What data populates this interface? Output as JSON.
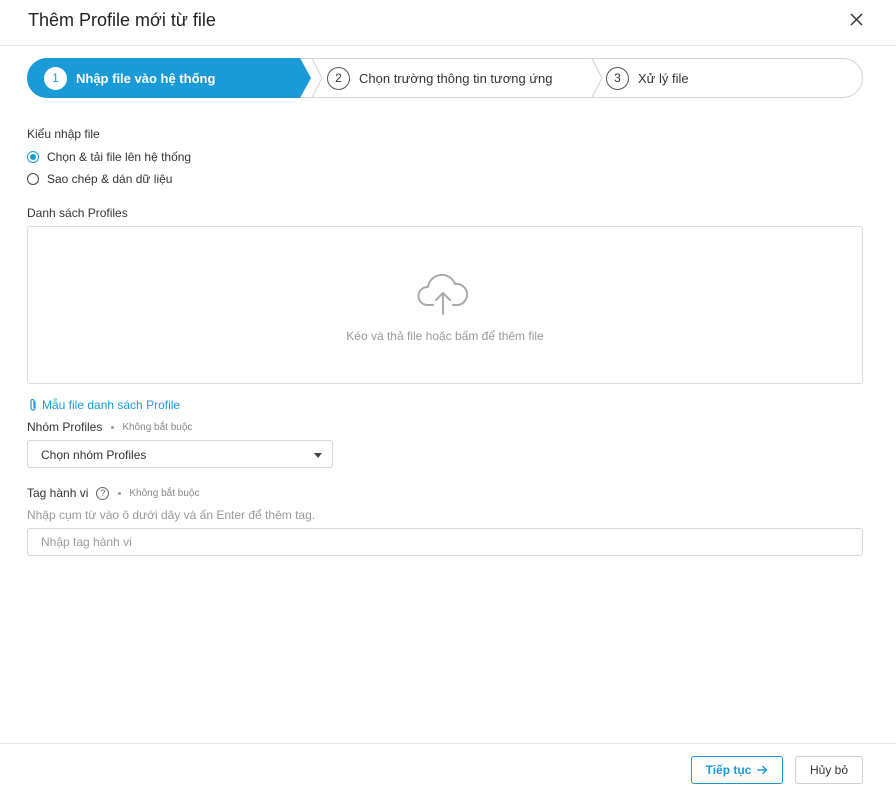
{
  "modal": {
    "title": "Thêm Profile mới từ file"
  },
  "stepper": {
    "steps": [
      {
        "number": "1",
        "label": "Nhập file vào hệ thống",
        "active": true
      },
      {
        "number": "2",
        "label": "Chọn trường thông tin tương ứng",
        "active": false
      },
      {
        "number": "3",
        "label": "Xử lý file",
        "active": false
      }
    ]
  },
  "import_type": {
    "label": "Kiểu nhập file",
    "options": [
      {
        "label": "Chọn & tải file lên hệ thống",
        "selected": true
      },
      {
        "label": "Sao chép & dán dữ liệu",
        "selected": false
      }
    ]
  },
  "profiles_list": {
    "label": "Danh sách Profiles",
    "dropzone_text": "Kéo và thả file hoặc bấm để thêm file",
    "template_link": "Mẫu file danh sách Profile"
  },
  "profile_group": {
    "label": "Nhóm Profiles",
    "optional": "Không bắt buộc",
    "selected": "Chọn nhóm Profiles"
  },
  "behavior_tag": {
    "label": "Tag hành vi",
    "help": "?",
    "optional": "Không bắt buộc",
    "hint": "Nhập cụm từ vào ô dưới dây và ấn Enter để thêm tag.",
    "placeholder": "Nhập tag hành vi"
  },
  "footer": {
    "continue_label": "Tiếp tục",
    "cancel_label": "Hủy bỏ"
  },
  "colors": {
    "accent": "#1a9ad6",
    "border": "#dcdcdc",
    "muted_text": "#999999"
  },
  "icons": {
    "close": "close-icon",
    "upload": "cloud-upload-icon",
    "attachment": "paperclip-icon",
    "next": "arrow-right-icon"
  }
}
